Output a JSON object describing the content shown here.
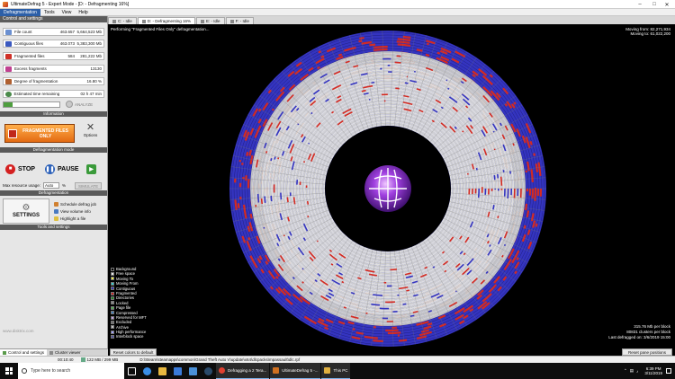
{
  "window": {
    "title": "UltimateDefrag 5 - Expert Mode - [D: - Defragmenting 16%]"
  },
  "menu": [
    "Defragmentation",
    "Tools",
    "View",
    "Help"
  ],
  "left": {
    "section_controls": "Control and settings",
    "stats": [
      {
        "label": "File count",
        "value": "463.657",
        "value2": "5,664,523 Mb",
        "color": "#6a8fd0"
      },
      {
        "label": "Contiguous files",
        "value": "463.073",
        "value2": "5,383,300 Mb",
        "color": "#3a58c0"
      },
      {
        "label": "Fragmented files",
        "value": "584",
        "value2": "281,222 Mb",
        "color": "#d03028"
      },
      {
        "label": "Excess fragments",
        "value": "",
        "value2": "13130",
        "color": "#c04090"
      },
      {
        "label": "Degree of fragmentation",
        "value": "",
        "value2": "16.80 %",
        "color": "#b06030"
      },
      {
        "label": "Estimated time remaining",
        "value": "",
        "value2": "02 h 47 min",
        "color": "#4a8a4a"
      }
    ],
    "progress": 0.16,
    "analyze_label": "ANALYZE",
    "section_information": "Information",
    "frag_button": "FRAGMENTED FILES ONLY",
    "options_label": "Options",
    "section_mode": "Defragmentation mode",
    "stop_label": "STOP",
    "pause_label": "PAUSE",
    "resource_label": "Max resource usage:",
    "resource_value": "Auto",
    "resource_unit": "%",
    "simulate_label": "SIMULATE",
    "section_defrag": "Defragmentation",
    "settings_label": "SETTINGS",
    "tools": [
      "Schedule defrag job",
      "View volume info",
      "Highlight a file"
    ],
    "section_tools": "Tools and settings",
    "watermark": "www.disktrix.com",
    "bottom_tabs": [
      "Control and settings",
      "Cluster viewer"
    ]
  },
  "tabs": [
    "C: - Idle",
    "D: - Defragmenting 16%",
    "E: - Idle",
    "F: - Idle"
  ],
  "map": {
    "status": "Performing \"Fragmented Files Only\" defragmentation...",
    "moving_from_label": "Moving from:",
    "moving_from_value": "82,271,934",
    "moving_to_label": "Moving to:",
    "moving_to_value": "61,022,200",
    "legend": [
      {
        "label": "Background",
        "color": "#000000"
      },
      {
        "label": "Free space",
        "color": "#e8e8e8"
      },
      {
        "label": "Moving To",
        "color": "#f0f040"
      },
      {
        "label": "Moving From",
        "color": "#30d0d0"
      },
      {
        "label": "Contiguous",
        "color": "#3030b8"
      },
      {
        "label": "Fragmented",
        "color": "#d02020"
      },
      {
        "label": "Directories",
        "color": "#208820"
      },
      {
        "label": "Locked",
        "color": "#8a8a8a"
      },
      {
        "label": "Page file",
        "color": "#50b050"
      },
      {
        "label": "Compressed",
        "color": "#4080c0"
      },
      {
        "label": "Reserved for MFT",
        "color": "#c0a0e0"
      },
      {
        "label": "Excluded",
        "color": "#707070"
      },
      {
        "label": "Archive",
        "color": "#c0c0c0"
      },
      {
        "label": "High performance",
        "color": "#a0a0ff"
      },
      {
        "label": "Interblock space",
        "color": "#5050a0"
      }
    ],
    "mb_per_block": "315.76 Mb per block",
    "clusters_per_block": "80831 clusters per block",
    "last_defragged": "Last defragged on: 3/6/2019 15:00",
    "reset_colors": "Reset colors to default",
    "reset_panes": "Reset pane positions"
  },
  "statusbar": {
    "path": "D:\\Steam\\steamapps\\common\\Grand Theft Auto V\\update\\x64\\dlcpacks\\mpassault\\dlc.rpf",
    "time": "00:10:40",
    "mem": "122 MB / 299 MB"
  },
  "taskbar": {
    "search": "Type here to search",
    "apps": [
      {
        "label": "Defragging a 2 Tera...",
        "color": "#e04030"
      },
      {
        "label": "UltimateDefrag 5 -...",
        "color": "#d07020"
      },
      {
        "label": "This PC",
        "color": "#e0b040"
      }
    ],
    "time": "6:39 PM",
    "date": "3/11/2019"
  },
  "colors": {
    "contiguous": "#3434c0",
    "fragmented": "#d42a22",
    "free": "#dedede",
    "orange": "#e36a12"
  }
}
